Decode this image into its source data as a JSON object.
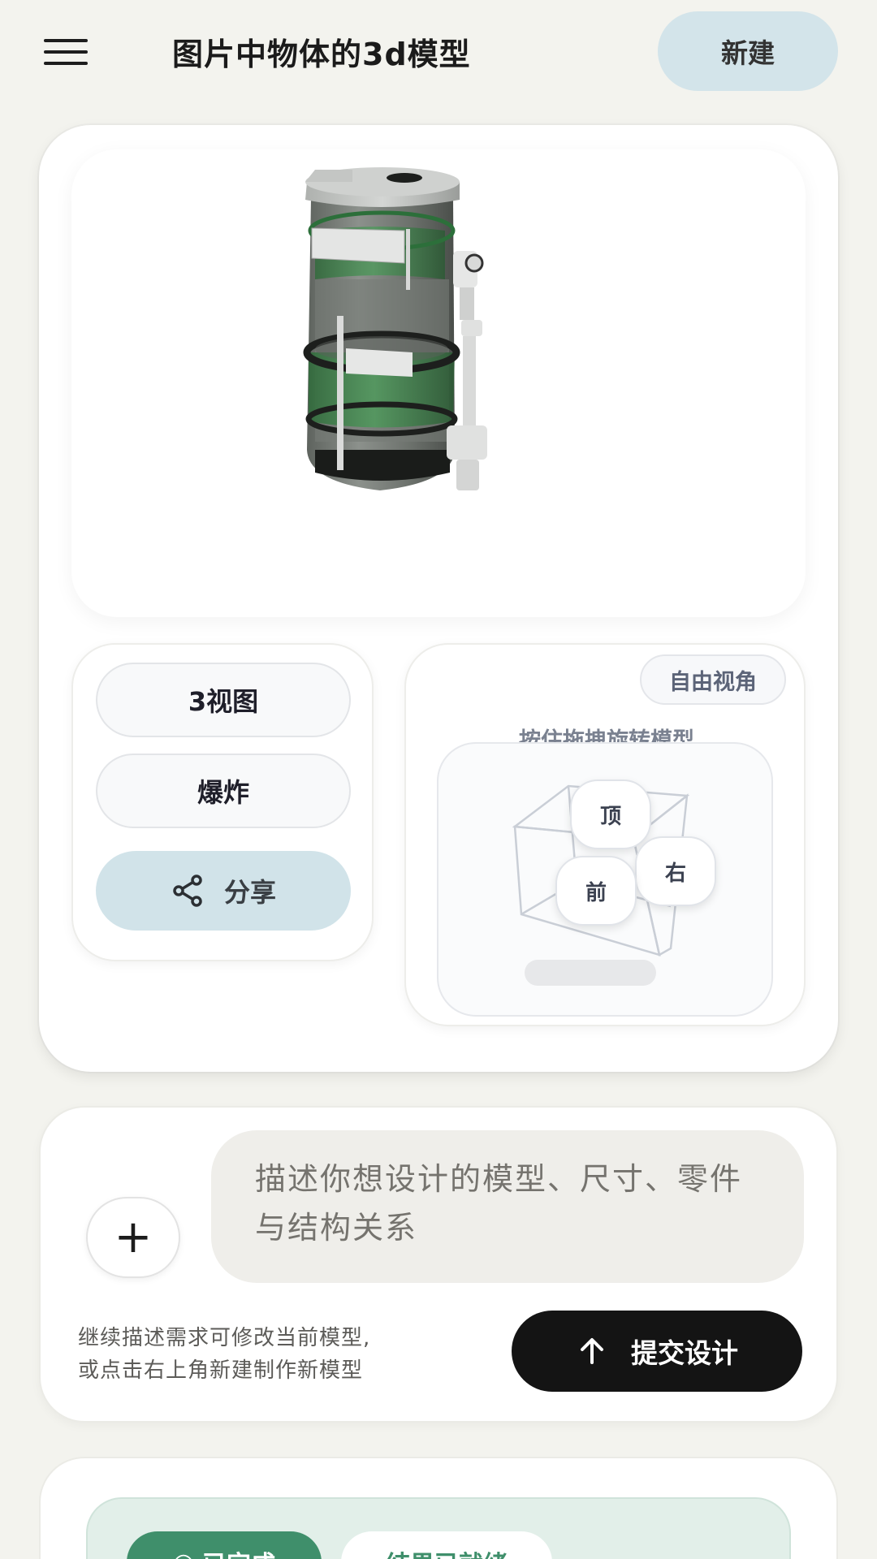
{
  "header": {
    "title": "图片中物体的3d模型",
    "new_button": "新建",
    "menu_icon": "hamburger-menu-icon"
  },
  "viewer": {
    "model_description": "",
    "buttons": {
      "three_view": "3视图",
      "explode": "爆炸",
      "share": "分享",
      "share_icon": "share-icon"
    },
    "view_control": {
      "badge": "自由视角",
      "hint": "按住拖拽旋转模型",
      "faces": {
        "top": "顶",
        "right": "右",
        "front": "前"
      }
    }
  },
  "composer": {
    "add_icon": "plus-icon",
    "placeholder": "描述你想设计的模型、尺寸、零件与结构关系",
    "hint_line1": "继续描述需求可修改当前模型,",
    "hint_line2": "或点击右上角新建制作新模型",
    "submit_label": "提交设计",
    "submit_icon": "arrow-up-icon"
  },
  "status": {
    "done_label": "已完成",
    "result_label": "结果已就绪"
  },
  "colors": {
    "background": "#f3f3ee",
    "accent_blue": "#d3e4ea",
    "accent_green": "#3f8f6b",
    "submit_dark": "#141414"
  }
}
